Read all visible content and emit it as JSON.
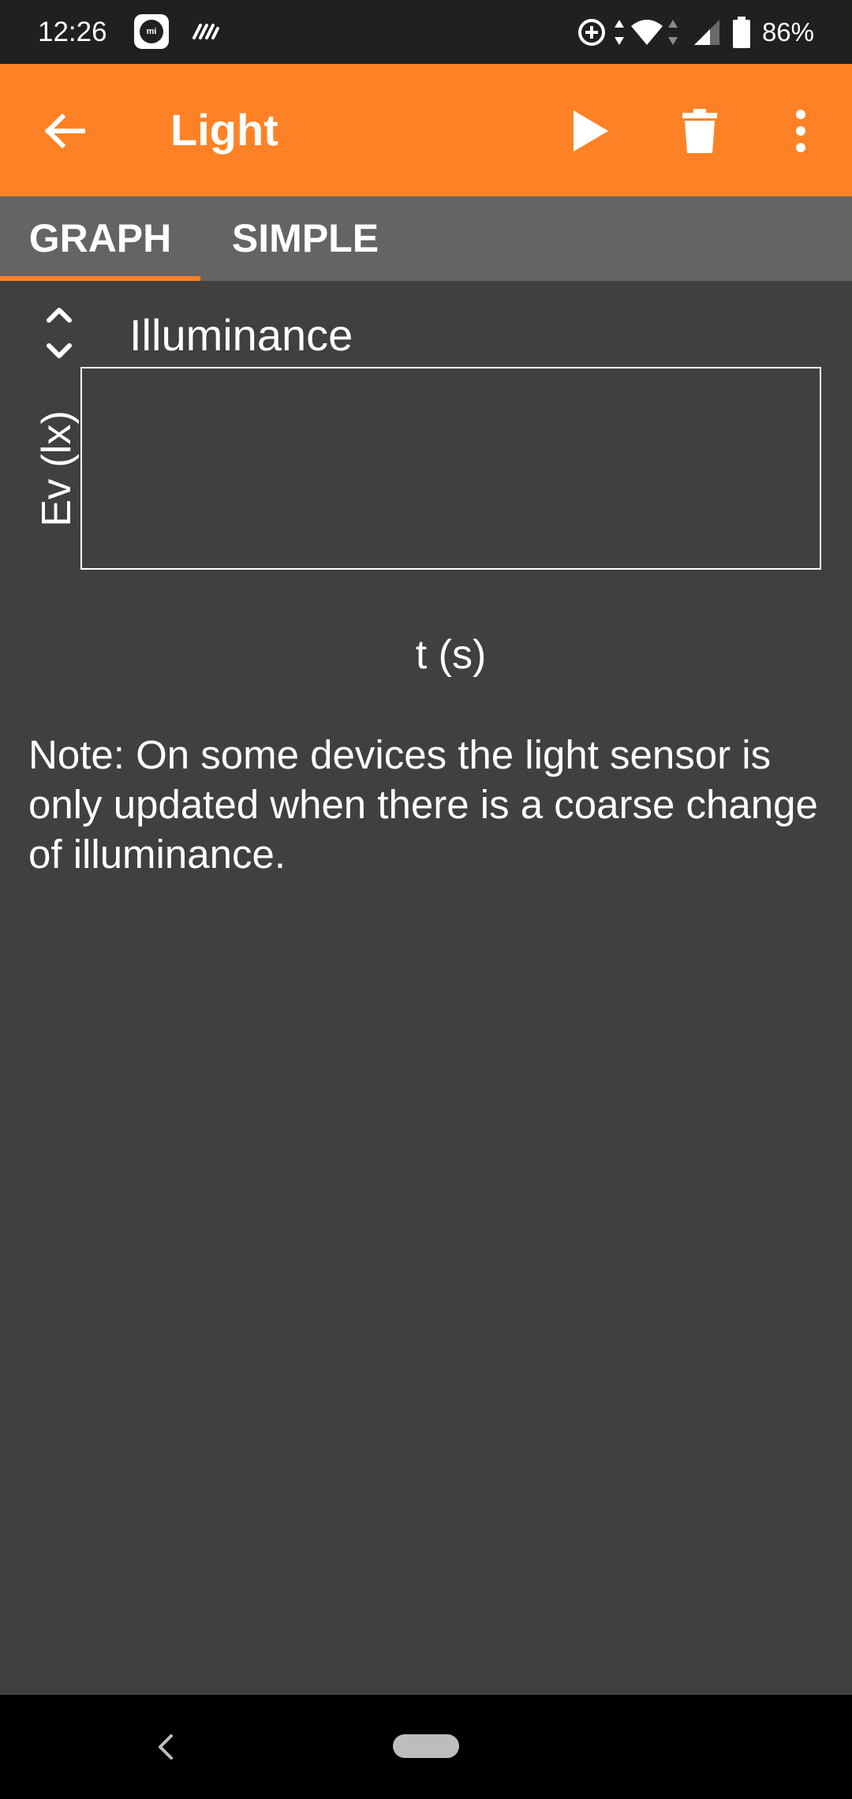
{
  "status_bar": {
    "time": "12:26",
    "mi_badge": "mi",
    "battery": "86%",
    "icons": [
      "mi-icon",
      "notification-icon",
      "data-saver-icon",
      "wifi-icon",
      "cell-signal-icon",
      "battery-icon"
    ]
  },
  "app_bar": {
    "title": "Light",
    "background_color": "#fe8225",
    "icons": [
      "back-arrow-icon",
      "play-icon",
      "trash-icon",
      "more-vert-icon"
    ]
  },
  "tabs": [
    {
      "label": "GRAPH",
      "selected": true
    },
    {
      "label": "SIMPLE",
      "selected": false
    }
  ],
  "graph": {
    "title": "Illuminance",
    "ylabel": "Ev (lx)",
    "xlabel": "t (s)",
    "toggle_icon": "unfold-more-icon"
  },
  "note": "Note: On some devices the light sensor is only updated when there is a coarse change of illuminance.",
  "nav_bar": {
    "icons": [
      "nav-back-icon",
      "home-pill"
    ]
  },
  "colors": {
    "accent": "#fe8225",
    "background": "#404040",
    "tab_bar": "#646464",
    "status_bar": "#202020"
  }
}
